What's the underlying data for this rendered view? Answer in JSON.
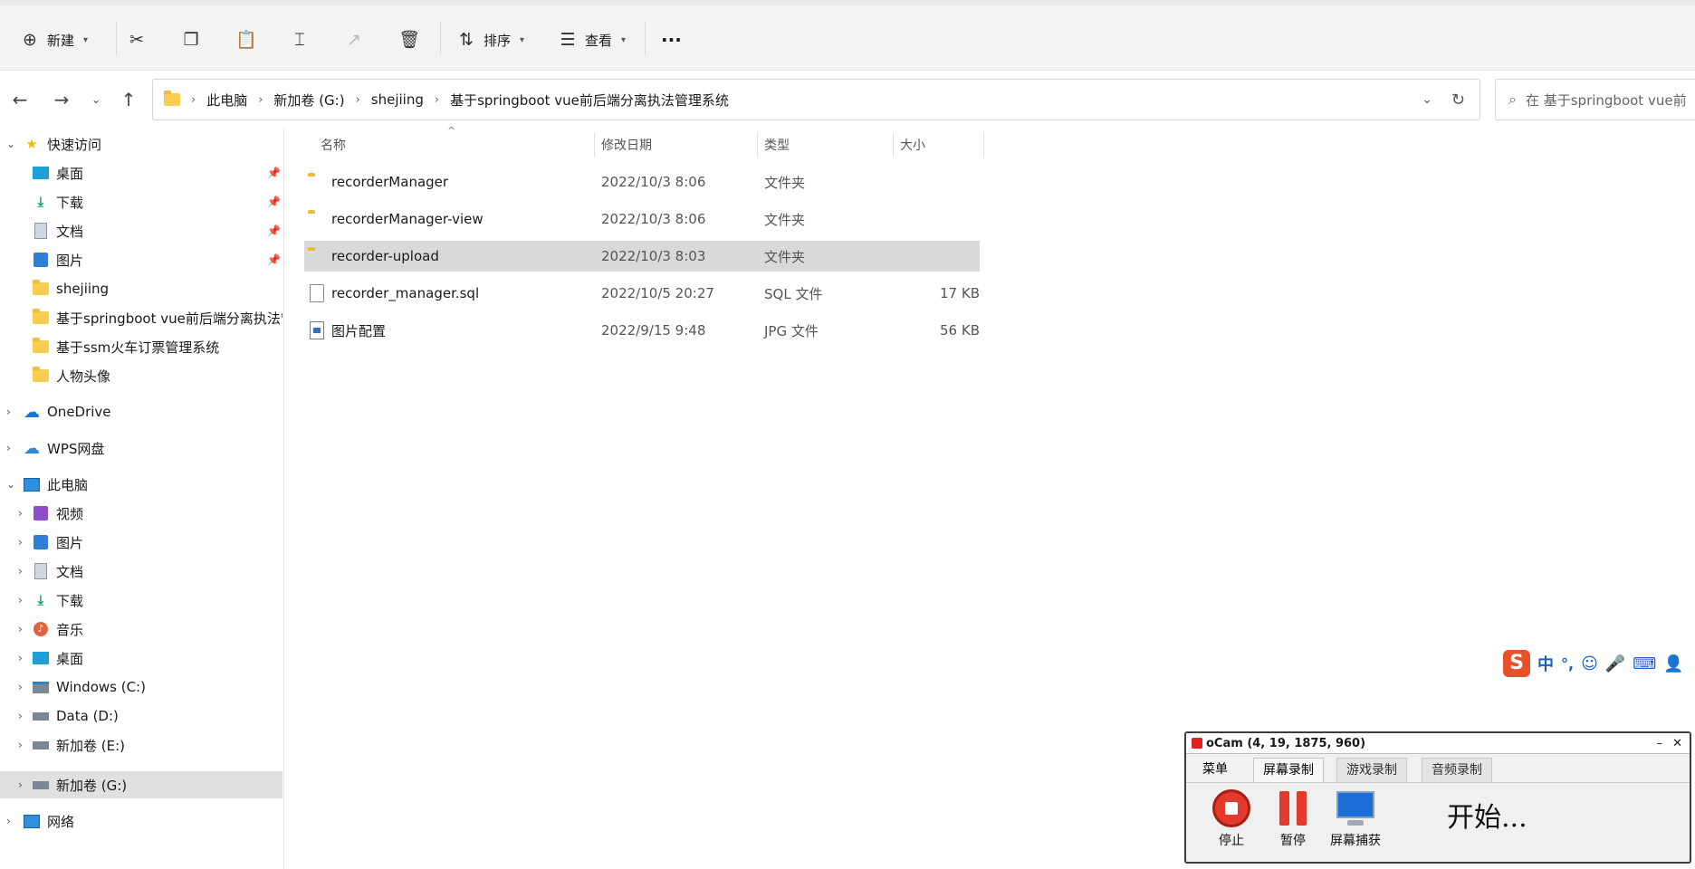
{
  "toolbar": {
    "new_label": "新建",
    "sort_label": "排序",
    "view_label": "查看",
    "more_label": "···"
  },
  "address": {
    "crumbs": [
      "此电脑",
      "新加卷 (G:)",
      "shejiing",
      "基于springboot vue前后端分离执法管理系统"
    ]
  },
  "search": {
    "placeholder": "在 基于springboot vue前"
  },
  "sidebar": {
    "quick_access": "快速访问",
    "quick_items": [
      {
        "label": "桌面",
        "pinned": true
      },
      {
        "label": "下载",
        "pinned": true
      },
      {
        "label": "文档",
        "pinned": true
      },
      {
        "label": "图片",
        "pinned": true
      },
      {
        "label": "shejiing",
        "pinned": false
      },
      {
        "label": "基于springboot vue前后端分离执法管理系统",
        "pinned": false
      },
      {
        "label": "基于ssm火车订票管理系统",
        "pinned": false
      },
      {
        "label": "人物头像",
        "pinned": false
      }
    ],
    "onedrive": "OneDrive",
    "wps": "WPS网盘",
    "this_pc": "此电脑",
    "pc_items": [
      "视频",
      "图片",
      "文档",
      "下载",
      "音乐",
      "桌面",
      "Windows (C:)",
      "Data (D:)",
      "新加卷 (E:)",
      "新加卷 (G:)"
    ],
    "network": "网络"
  },
  "columns": {
    "name": "名称",
    "modified": "修改日期",
    "type": "类型",
    "size": "大小"
  },
  "files": [
    {
      "name": "recorderManager",
      "date": "2022/10/3 8:06",
      "type": "文件夹",
      "size": ""
    },
    {
      "name": "recorderManager-view",
      "date": "2022/10/3 8:06",
      "type": "文件夹",
      "size": ""
    },
    {
      "name": "recorder-upload",
      "date": "2022/10/3 8:03",
      "type": "文件夹",
      "size": ""
    },
    {
      "name": "recorder_manager.sql",
      "date": "2022/10/5 20:27",
      "type": "SQL 文件",
      "size": "17 KB"
    },
    {
      "name": "图片配置",
      "date": "2022/9/15 9:48",
      "type": "JPG 文件",
      "size": "56 KB"
    }
  ],
  "ime": {
    "mode": "中",
    "punct": "°,"
  },
  "ocam": {
    "title": "oCam (4, 19, 1875, 960)",
    "tabs": [
      "菜单",
      "屏幕录制",
      "游戏录制",
      "音频录制"
    ],
    "stop_label": "停止",
    "pause_label": "暂停",
    "capture_label": "屏幕捕获",
    "status": "开始..."
  }
}
